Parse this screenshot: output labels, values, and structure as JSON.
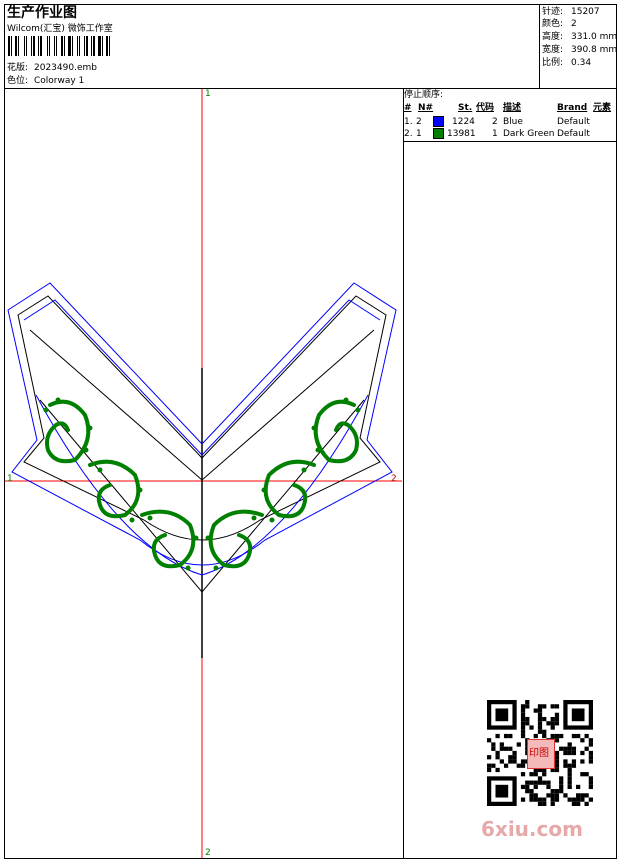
{
  "header": {
    "title": "生产作业图",
    "company": "Wilcom(汇宝) 微饰工作室",
    "design_label": "花版:",
    "design_value": "2023490.emb",
    "colorway_label": "色位:",
    "colorway_value": "Colorway 1"
  },
  "stats": {
    "stitches_label": "针迹:",
    "stitches_value": "15207",
    "colors_label": "颜色:",
    "colors_value": "2",
    "height_label": "高度:",
    "height_value": "331.0 mm",
    "width_label": "宽度:",
    "width_value": "390.8 mm",
    "scale_label": "比例:",
    "scale_value": "0.34"
  },
  "stop_sequence": {
    "title": "停止顺序:",
    "headers": [
      "#",
      "N#",
      "St.",
      "代码",
      "描述",
      "Brand",
      "元素"
    ],
    "rows": [
      {
        "num": "1.",
        "n": "2",
        "color": "#0000ff",
        "st": "1224",
        "code": "2",
        "desc": "Blue",
        "brand": "Default"
      },
      {
        "num": "2.",
        "n": "1",
        "color": "#008000",
        "st": "13981",
        "code": "1",
        "desc": "Dark Green",
        "brand": "Default"
      }
    ]
  },
  "axes": {
    "top": "1",
    "bottom": "2",
    "left": "1",
    "right": "2"
  },
  "watermark": {
    "site": "6xiu.com",
    "seal_text": "印图"
  },
  "colors": {
    "axis": "#ff0000",
    "outline": "#0000ff",
    "stitch": "#008000"
  }
}
